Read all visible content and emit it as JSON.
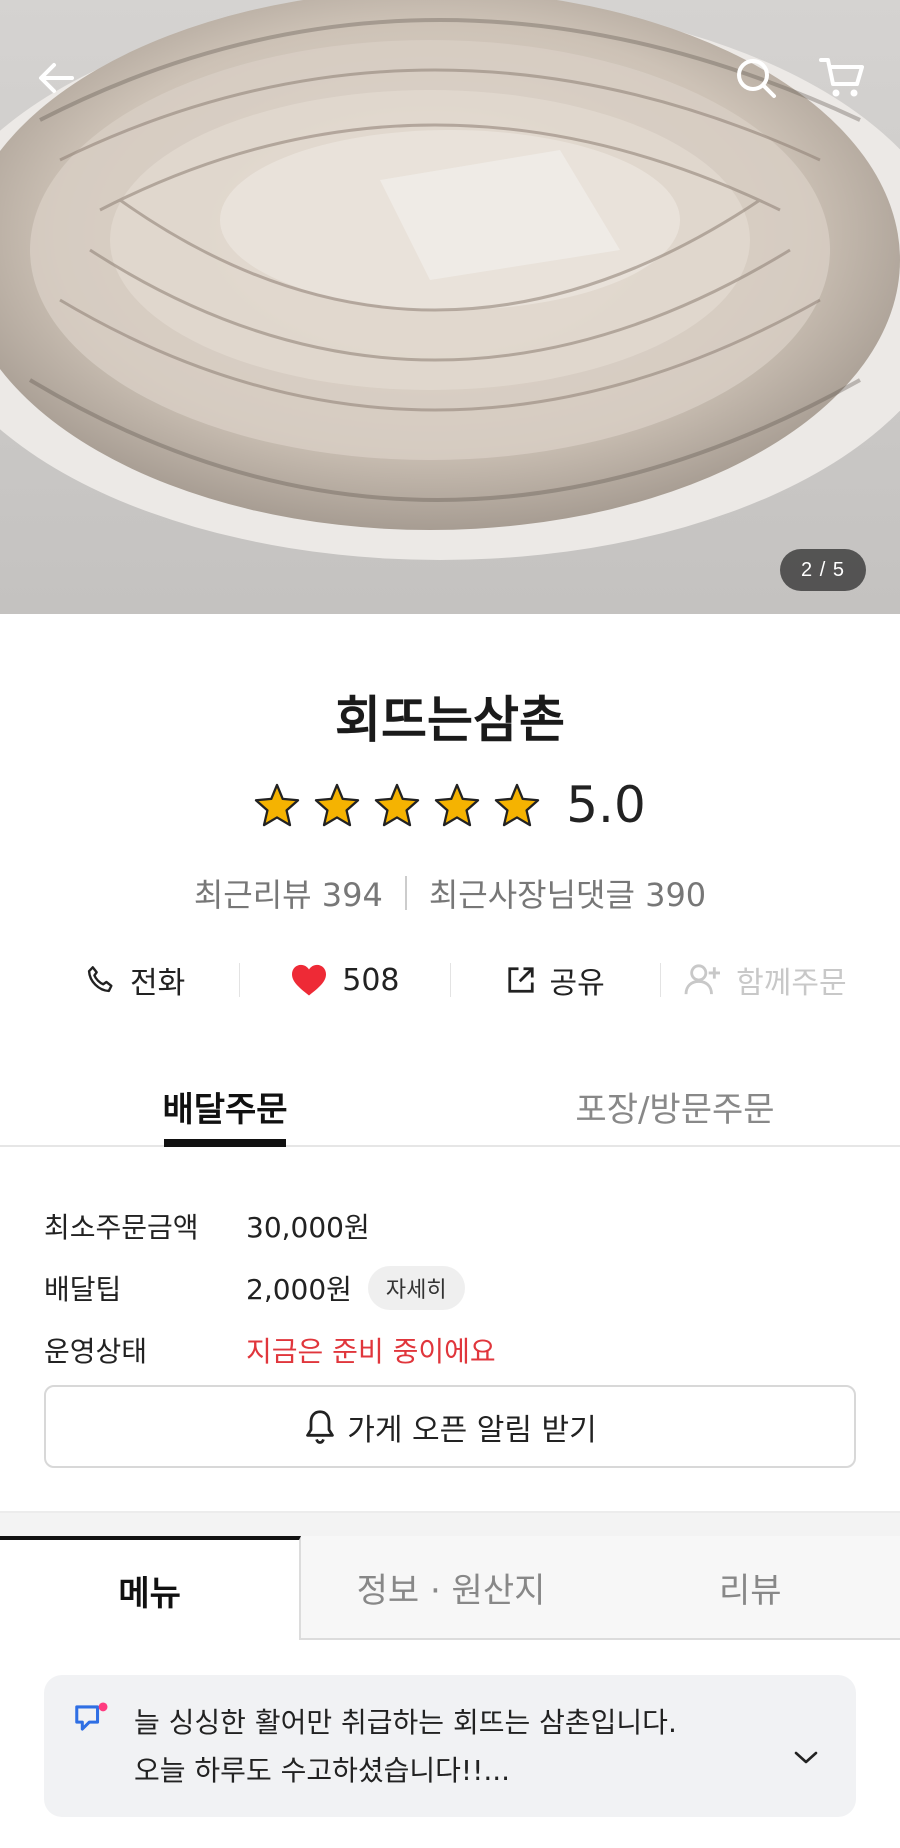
{
  "hero": {
    "image_counter": "2 / 5",
    "icons": {
      "back": "arrow-left-icon",
      "search": "search-icon",
      "cart": "cart-icon"
    }
  },
  "store": {
    "name": "회뜨는삼촌",
    "rating_stars": 5,
    "rating_score": "5.0",
    "recent_reviews": "최근리뷰 394",
    "owner_replies": "최근사장님댓글 390"
  },
  "actions": {
    "phone_label": "전화",
    "like_count": "508",
    "share_label": "공유",
    "group_order_label": "함께주문"
  },
  "order_tabs": [
    {
      "label": "배달주문",
      "active": true
    },
    {
      "label": "포장/방문주문",
      "active": false
    }
  ],
  "info": {
    "min_order_label": "최소주문금액",
    "min_order_value": "30,000원",
    "delivery_tip_label": "배달팁",
    "delivery_tip_value": "2,000원",
    "detail_label": "자세히",
    "status_label": "운영상태",
    "status_value": "지금은 준비 중이에요"
  },
  "alarm_button": "가게 오픈 알림 받기",
  "menu_tabs": [
    {
      "label": "메뉴",
      "active": true
    },
    {
      "label": "정보 · 원산지",
      "active": false
    },
    {
      "label": "리뷰",
      "active": false
    }
  ],
  "notice": {
    "line1": "늘 싱싱한 활어만 취급하는 회뜨는 삼촌입니다.",
    "line2": "오늘 하루도 수고하셨습니다!!..."
  },
  "colors": {
    "accent_red": "#e0363c",
    "star_gold": "#f5b301",
    "heart_red": "#ee2a36"
  }
}
